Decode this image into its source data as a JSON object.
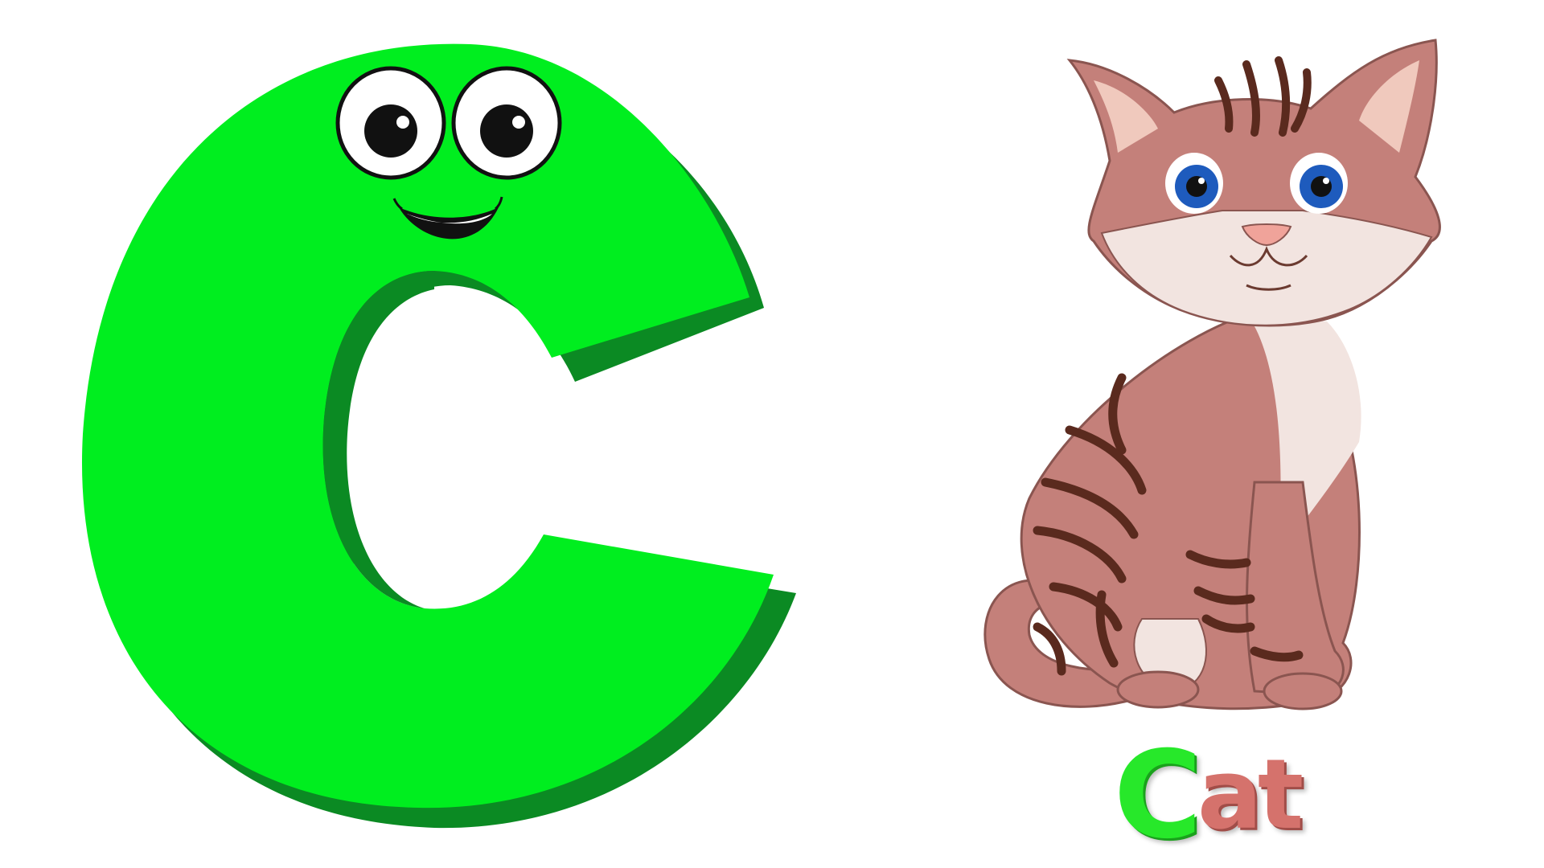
{
  "scene": {
    "letter": "C",
    "word_first_letter": "C",
    "word_rest": "at",
    "word": "Cat"
  },
  "colors": {
    "background": "#ffffff",
    "letter_fill": "#00ee1f",
    "letter_shadow": "#0b8a23",
    "cat_body": "#c4807a",
    "cat_stripes": "#5a2a1e",
    "cat_white": "#f2e4e0",
    "cat_eye_iris": "#1e5bbd",
    "word_first_color": "#27e82a",
    "word_rest_color": "#d5726c"
  },
  "icons": {
    "letter_character": "smiling-letter-c-icon",
    "animal": "cat-icon"
  }
}
